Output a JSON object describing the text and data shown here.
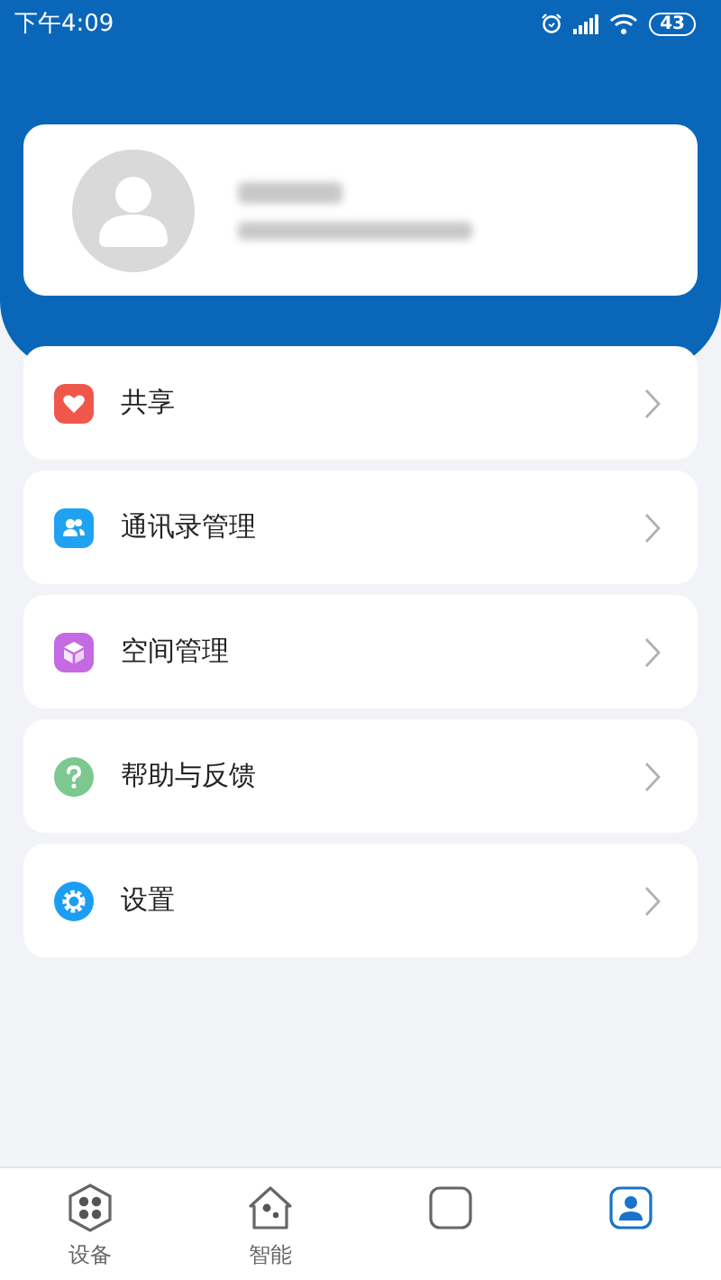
{
  "status_bar": {
    "time": "下午4:09",
    "battery": "43"
  },
  "menu": [
    {
      "label": "共享",
      "kind": "heart",
      "color": "#f0574b"
    },
    {
      "label": "通讯录管理",
      "kind": "contacts",
      "color": "#1fa2f2"
    },
    {
      "label": "空间管理",
      "kind": "cube",
      "color": "#c56ae2"
    },
    {
      "label": "帮助与反馈",
      "kind": "help",
      "color": "#7cc890"
    },
    {
      "label": "设置",
      "kind": "settings",
      "color": "#1b9ef2"
    }
  ],
  "bottom_nav": [
    {
      "label": "设备",
      "kind": "devices",
      "selected": false
    },
    {
      "label": "智能",
      "kind": "smart",
      "selected": false
    },
    {
      "kind": "box",
      "selected": false
    },
    {
      "kind": "profile",
      "selected": true
    }
  ]
}
